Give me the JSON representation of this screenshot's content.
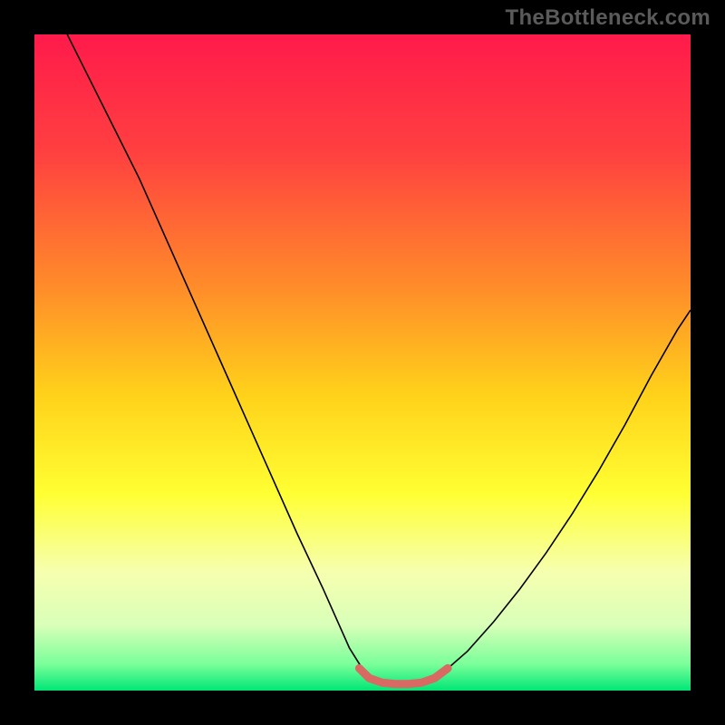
{
  "watermark": {
    "text": "TheBottleneck.com"
  },
  "chart_data": {
    "type": "line",
    "title": "",
    "xlabel": "",
    "ylabel": "",
    "xlim": [
      0,
      100
    ],
    "ylim": [
      0,
      100
    ],
    "gradient_stops": [
      {
        "offset": 0.0,
        "color": "#ff1a4b"
      },
      {
        "offset": 0.18,
        "color": "#ff4040"
      },
      {
        "offset": 0.38,
        "color": "#ff8a2a"
      },
      {
        "offset": 0.55,
        "color": "#ffd21a"
      },
      {
        "offset": 0.7,
        "color": "#ffff33"
      },
      {
        "offset": 0.82,
        "color": "#f6ffb0"
      },
      {
        "offset": 0.9,
        "color": "#d9ffb8"
      },
      {
        "offset": 0.96,
        "color": "#7aff9a"
      },
      {
        "offset": 1.0,
        "color": "#00e676"
      }
    ],
    "series": [
      {
        "name": "left-branch",
        "stroke": "#000000",
        "stroke_width": 1.6,
        "x": [
          5.0,
          8.0,
          12.0,
          16.0,
          20.0,
          24.0,
          28.0,
          32.0,
          36.0,
          40.0,
          44.0,
          48.0,
          50.5
        ],
        "y": [
          100.0,
          94.0,
          86.0,
          78.0,
          69.0,
          60.0,
          51.0,
          42.0,
          33.0,
          24.0,
          15.5,
          6.5,
          2.5
        ]
      },
      {
        "name": "right-branch",
        "stroke": "#000000",
        "stroke_width": 1.6,
        "x": [
          62.0,
          66.0,
          70.0,
          74.0,
          78.0,
          82.0,
          86.0,
          90.0,
          94.0,
          98.0,
          100.0
        ],
        "y": [
          2.5,
          6.0,
          10.5,
          15.5,
          21.0,
          27.0,
          33.5,
          40.5,
          48.0,
          55.0,
          58.0
        ]
      },
      {
        "name": "trough-marker",
        "stroke": "#d86a63",
        "stroke_width": 9,
        "linecap": "round",
        "x": [
          49.5,
          51.0,
          53.0,
          55.0,
          57.0,
          59.0,
          61.0,
          63.0
        ],
        "y": [
          3.4,
          1.9,
          1.2,
          1.0,
          1.0,
          1.2,
          1.9,
          3.4
        ]
      }
    ]
  }
}
